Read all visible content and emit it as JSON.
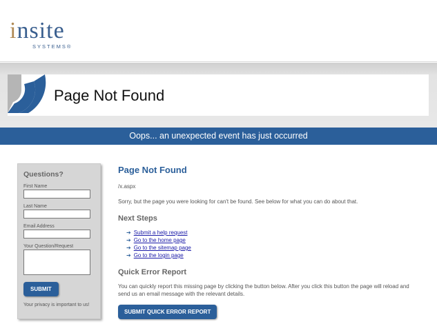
{
  "header": {
    "logo_text_i": "i",
    "logo_text_rest": "nsite",
    "logo_sub": "SYSTEMS®"
  },
  "banner": {
    "title": "Page Not Found",
    "notice": "Oops... an unexpected event has just occurred"
  },
  "sidebar": {
    "title": "Questions?",
    "first_name_label": "First Name",
    "last_name_label": "Last Name",
    "email_label": "Email Address",
    "question_label": "Your Question/Request",
    "submit_label": "SUBMIT",
    "privacy": "Your privacy is important to us!"
  },
  "main": {
    "heading": "Page Not Found",
    "path": "/x.aspx",
    "message": "Sorry, but the page you were looking for can't be found. See below for what you can do about that.",
    "next_steps_heading": "Next Steps",
    "links": [
      "Submit a help request",
      "Go to the home page",
      "Go to the sitemap page",
      "Go to the login page"
    ],
    "quick_report_heading": "Quick Error Report",
    "quick_report_text": "You can quickly report this missing page by clicking the button below. After you click this button the page will reload and send us an email message with the relevant details.",
    "quick_report_button": "SUBMIT QUICK ERROR REPORT"
  },
  "colors": {
    "brand_blue": "#2b5f9a",
    "link_blue": "#1a1aa8",
    "arc_grey": "#b5b5b5"
  }
}
